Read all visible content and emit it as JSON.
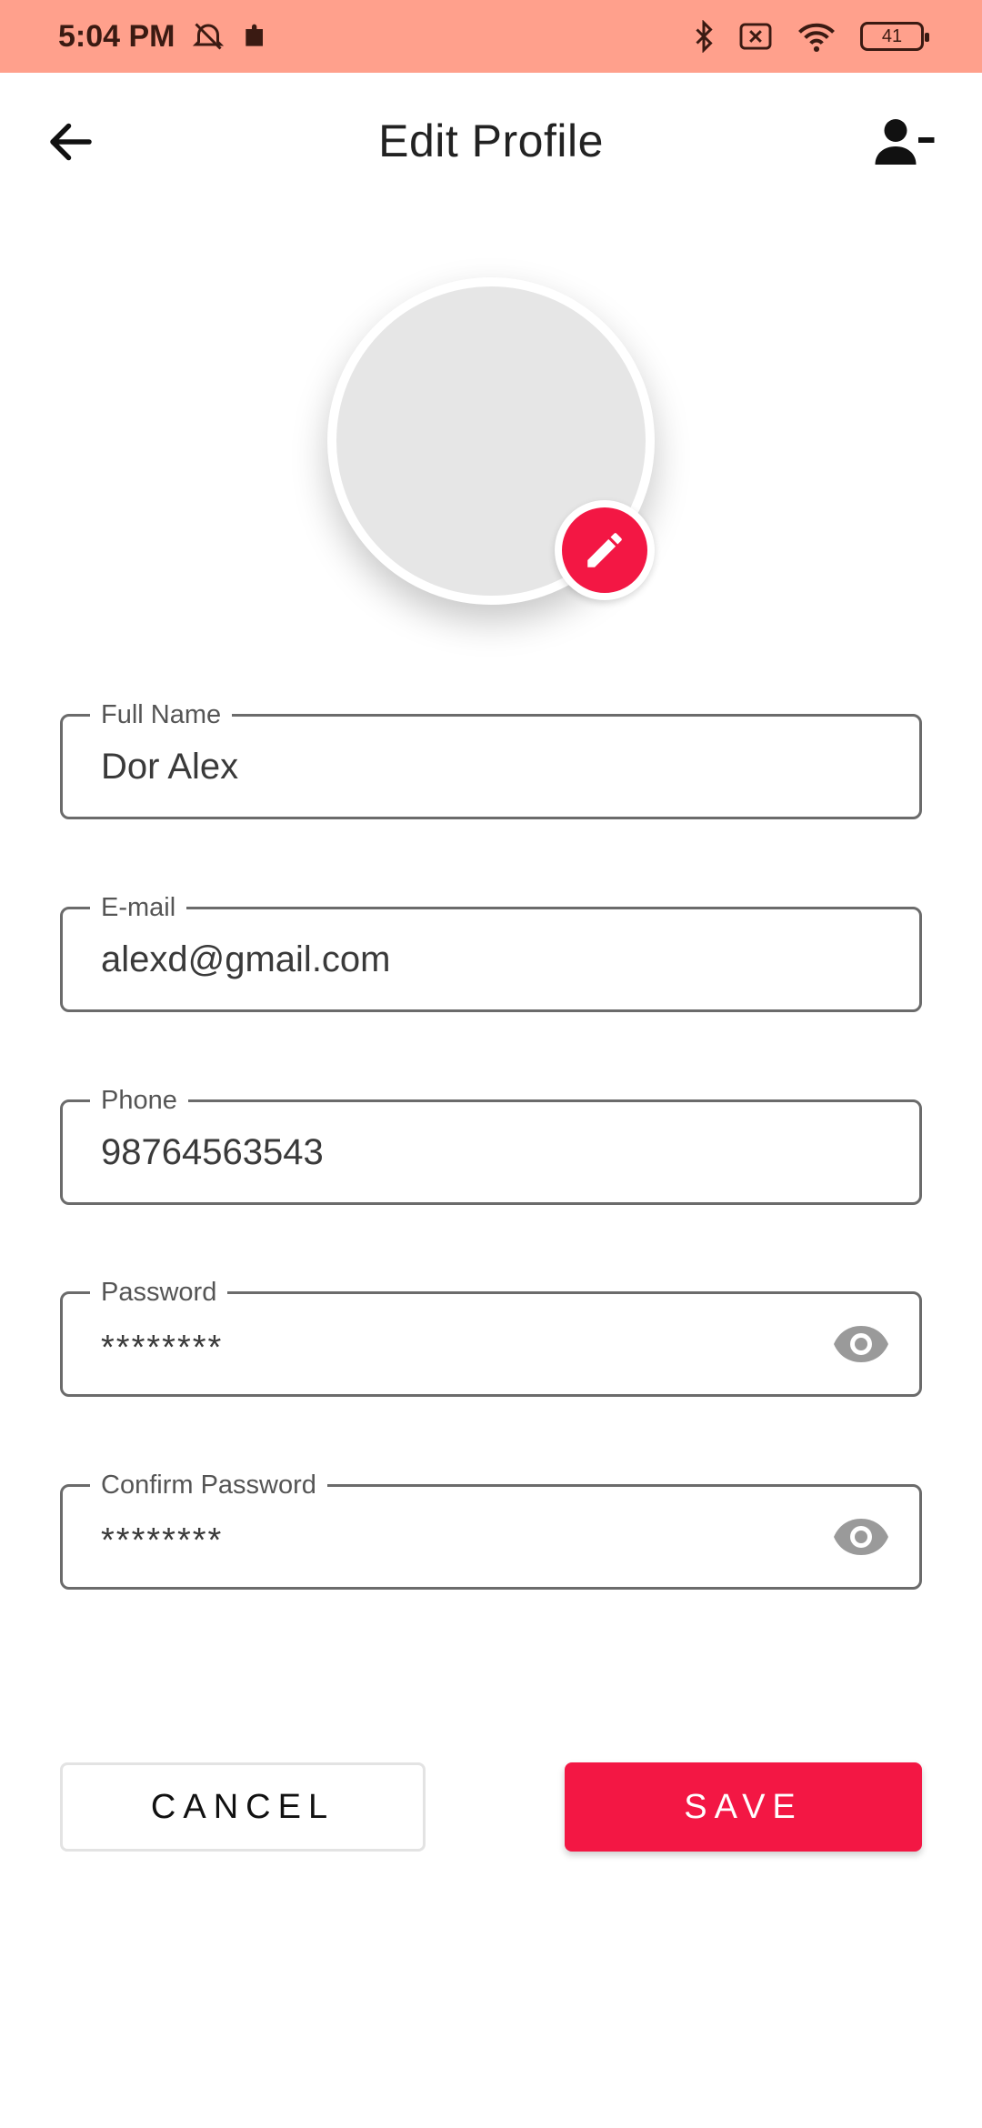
{
  "status_bar": {
    "time": "5:04 PM",
    "battery": "41",
    "icons": [
      "muted-alarm-icon",
      "puzzle-icon",
      "bluetooth-icon",
      "sim-off-icon",
      "wifi-icon",
      "battery-icon"
    ]
  },
  "header": {
    "title": "Edit Profile",
    "back_icon": "arrow-left-icon",
    "action_icon": "user-minus-icon"
  },
  "avatar": {
    "edit_icon": "pencil-icon"
  },
  "fields": {
    "full_name": {
      "label": "Full Name",
      "value": "Dor Alex"
    },
    "email": {
      "label": "E-mail",
      "value": "alexd@gmail.com"
    },
    "phone": {
      "label": "Phone",
      "value": "98764563543"
    },
    "password": {
      "label": "Password",
      "value": "********",
      "toggle_icon": "eye-icon"
    },
    "confirm_password": {
      "label": "Confirm Password",
      "value": "********",
      "toggle_icon": "eye-icon"
    }
  },
  "actions": {
    "cancel_label": "CANCEL",
    "save_label": "SAVE"
  },
  "colors": {
    "status_bar": "#FFA08C",
    "accent": "#F31744",
    "avatar_fill": "#E6E6E6",
    "field_border": "#6B6B6B"
  }
}
